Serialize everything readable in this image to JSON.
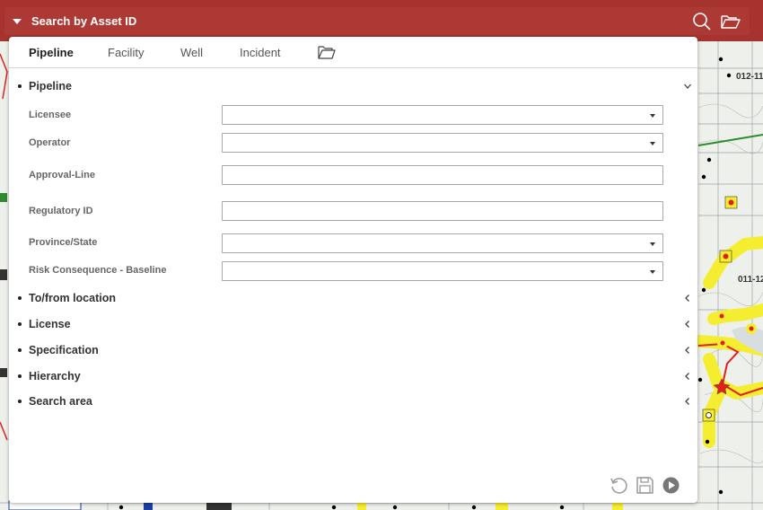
{
  "header": {
    "title": "Search by Asset ID",
    "bg_color": "#a7332e"
  },
  "tabs": [
    {
      "label": "Pipeline",
      "active": true
    },
    {
      "label": "Facility",
      "active": false
    },
    {
      "label": "Well",
      "active": false
    },
    {
      "label": "Incident",
      "active": false
    }
  ],
  "pipeline_section": {
    "title": "Pipeline",
    "expanded": true,
    "fields": {
      "licensee": {
        "label": "Licensee",
        "value": ""
      },
      "operator": {
        "label": "Operator",
        "value": ""
      },
      "approval_line": {
        "label": "Approval-Line",
        "value": ""
      },
      "regulatory_id": {
        "label": "Regulatory ID",
        "value": ""
      },
      "province_state": {
        "label": "Province/State",
        "value": ""
      },
      "risk_consequence": {
        "label": "Risk Consequence - Baseline",
        "value": ""
      }
    }
  },
  "collapsed_sections": [
    {
      "title": "To/from location"
    },
    {
      "title": "License"
    },
    {
      "title": "Specification"
    },
    {
      "title": "Hierarchy"
    },
    {
      "title": "Search area"
    }
  ],
  "map": {
    "labels": [
      "012-11",
      "011-12"
    ],
    "colors": {
      "pipeline_red": "#e02020",
      "buffer_yellow": "#f5ee30",
      "line_green": "#2e8b2e"
    }
  },
  "icons": [
    "caret-down-icon",
    "search-icon",
    "folder-open-icon",
    "chevron-down-icon",
    "chevron-left-icon",
    "reset-icon",
    "save-icon",
    "play-icon"
  ]
}
